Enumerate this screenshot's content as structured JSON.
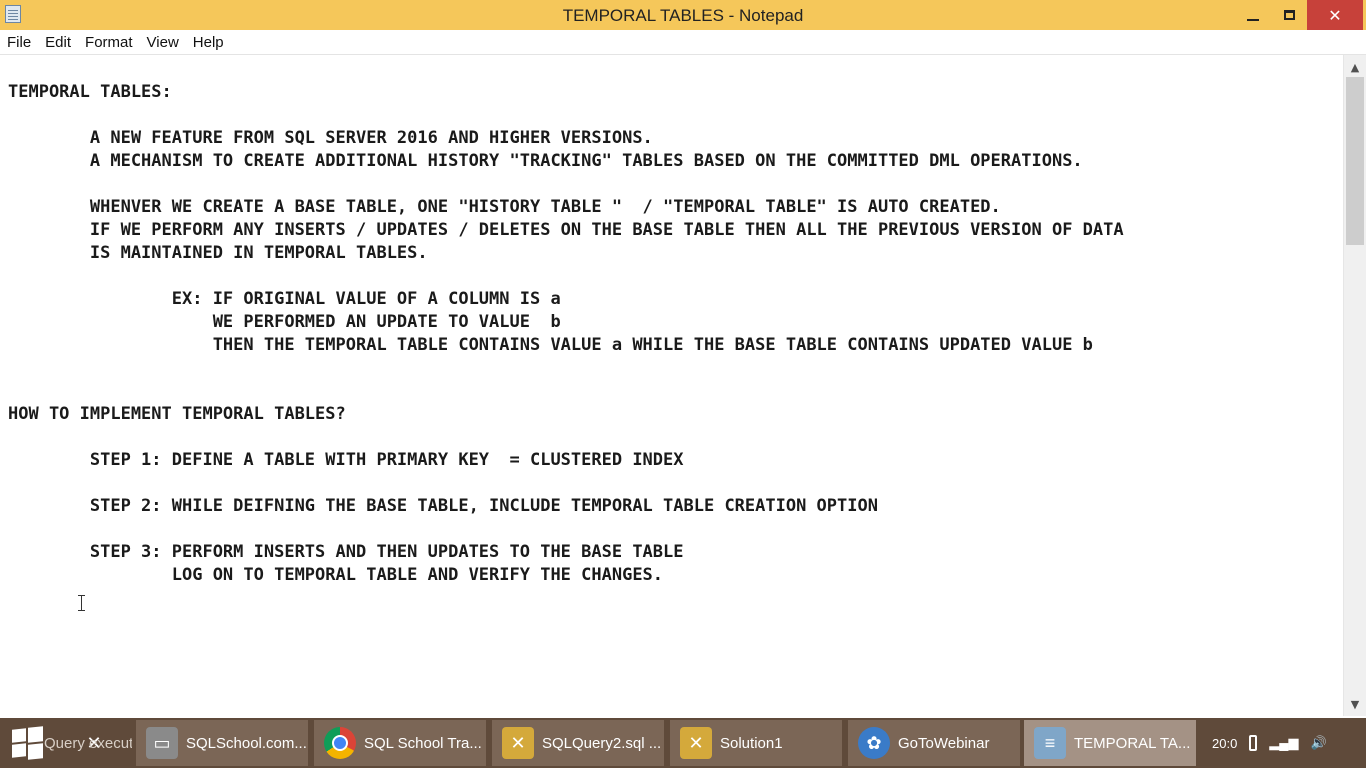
{
  "window": {
    "title": "TEMPORAL TABLES - Notepad",
    "minimize_glyph": "",
    "maximize_glyph": "",
    "close_glyph": "✕"
  },
  "menu": [
    "File",
    "Edit",
    "Format",
    "View",
    "Help"
  ],
  "document": {
    "text": "TEMPORAL TABLES:\n\n        A NEW FEATURE FROM SQL SERVER 2016 AND HIGHER VERSIONS.\n        A MECHANISM TO CREATE ADDITIONAL HISTORY \"TRACKING\" TABLES BASED ON THE COMMITTED DML OPERATIONS.\n\n        WHENVER WE CREATE A BASE TABLE, ONE \"HISTORY TABLE \"  / \"TEMPORAL TABLE\" IS AUTO CREATED.\n        IF WE PERFORM ANY INSERTS / UPDATES / DELETES ON THE BASE TABLE THEN ALL THE PREVIOUS VERSION OF DATA\n        IS MAINTAINED IN TEMPORAL TABLES.\n\n                EX: IF ORIGINAL VALUE OF A COLUMN IS a\n                    WE PERFORMED AN UPDATE TO VALUE  b\n                    THEN THE TEMPORAL TABLE CONTAINS VALUE a WHILE THE BASE TABLE CONTAINS UPDATED VALUE b\n\n\nHOW TO IMPLEMENT TEMPORAL TABLES?\n\n        STEP 1: DEFINE A TABLE WITH PRIMARY KEY  = CLUSTERED INDEX\n\n        STEP 2: WHILE DEIFNING THE BASE TABLE, INCLUDE TEMPORAL TABLE CREATION OPTION\n\n        STEP 3: PERFORM INSERTS AND THEN UPDATES TO THE BASE TABLE\n                LOG ON TO TEMPORAL TABLE AND VERIFY THE CHANGES."
  },
  "scrollbar": {
    "up_glyph": "▲",
    "down_glyph": "▼"
  },
  "taskbar": {
    "items": [
      {
        "label": "Query executed succe",
        "icon": "ssms-tools-icon",
        "color": "#c9a43a",
        "active": false
      },
      {
        "label": "SQLSchool.com...",
        "icon": "network-drive-icon",
        "color": "#8a8a8a",
        "active": false
      },
      {
        "label": "SQL School Tra...",
        "icon": "chrome-icon",
        "color": "#db4437",
        "active": false
      },
      {
        "label": "SQLQuery2.sql ...",
        "icon": "ssms-icon",
        "color": "#d4a93b",
        "active": false
      },
      {
        "label": "Solution1",
        "icon": "ssms-icon",
        "color": "#d4a93b",
        "active": false
      },
      {
        "label": "GoToWebinar",
        "icon": "gotowebinar-icon",
        "color": "#3a7bc8",
        "active": false
      },
      {
        "label": "TEMPORAL TA...",
        "icon": "notepad-icon",
        "color": "#7fa6c8",
        "active": true
      }
    ],
    "tray": [
      "20:0",
      "wifi",
      "vol"
    ]
  },
  "colors": {
    "title_bar": "#f5c75a",
    "close_button": "#c7413a",
    "taskbar": "#5f4a3a"
  }
}
